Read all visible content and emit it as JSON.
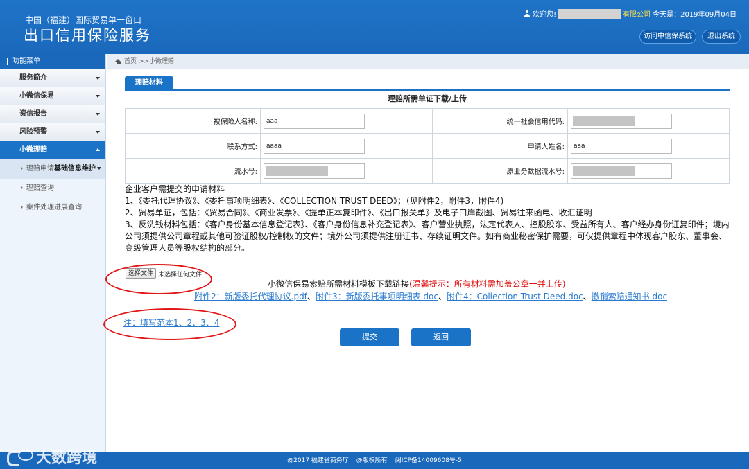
{
  "header": {
    "org": "中国（福建）国际贸易单一窗口",
    "system_title": "出口信用保险服务",
    "welcome_prefix": "欢迎您!",
    "company_suffix": "有限公司",
    "today_label": "今天是：2019年09月04日",
    "visit_button": "访问中信保系统",
    "logout_button": "退出系统"
  },
  "sidebar": {
    "heading": "功能菜单",
    "items": [
      {
        "label": "服务简介"
      },
      {
        "label": "小微信保易"
      },
      {
        "label": "资信报告"
      },
      {
        "label": "风险预警"
      },
      {
        "label": "小微理赔"
      }
    ],
    "subitems": [
      {
        "label_prefix": "理赔申请",
        "label_bold": "基础信息维护"
      },
      {
        "label": "理赔查询"
      },
      {
        "label": "案件处理进展查询"
      }
    ]
  },
  "breadcrumb": {
    "text": "首页 >>小微理赔"
  },
  "main": {
    "tab": "理赔材料",
    "form_title": "理赔所需单证下载/上传",
    "fields": {
      "insured_name_label": "被保险人名称:",
      "insured_name_value": "aaa",
      "credit_code_label": "统一社会信用代码:",
      "contact_label": "联系方式:",
      "contact_value": "aaaa",
      "applicant_label": "申请人姓名:",
      "applicant_value": "aaa",
      "serial_label": "流水号:",
      "orig_serial_label": "原业务数据流水号:"
    },
    "desc": {
      "heading": "企业客户需提交的申请材料",
      "item1": "1、《委托代理协议》、《委托事项明细表》、《COLLECTION TRUST DEED》；（见附件2，附件3，附件4)",
      "item2": "2、贸易单证，包括：《贸易合同》、《商业发票》、《提单正本复印件》、《出口报关单》及电子口岸截图、贸易往来函电、收汇证明",
      "item3": "3、反洗钱材料包括：《客户身份基本信息登记表》、《客户身份信息补充登记表》、客户营业执照，法定代表人、控股股东、受益所有人、客户经办身份证复印件；境内公司须提供公司章程或其他可验证股权/控制权的文件；境外公司须提供注册证书、存续证明文件。如有商业秘密保护需要，可仅提供章程中体现客户股东、董事会、高级管理人员等股权结构的部分。"
    },
    "file": {
      "button": "选择文件",
      "status": "未选择任何文件"
    },
    "templates": {
      "title": "小微信保易索赔所需材料模板下载链接",
      "warning": "(温馨提示：所有材料需加盖公章一并上传)",
      "links": [
        "附件2：新版委托代理协议.pdf",
        "附件3：新版委托事项明细表.doc",
        "附件4：Collection Trust Deed.doc",
        "撤销索赔通知书.doc"
      ],
      "separator": "、"
    },
    "note": "注：填写范本1、2、3、4",
    "submit": "提交",
    "back": "返回"
  },
  "footer": {
    "copyright": "@2017 福建省商务厅",
    "rights": "@版权所有",
    "icp": "闽ICP备14009608号-5"
  },
  "watermark": "大数跨境"
}
